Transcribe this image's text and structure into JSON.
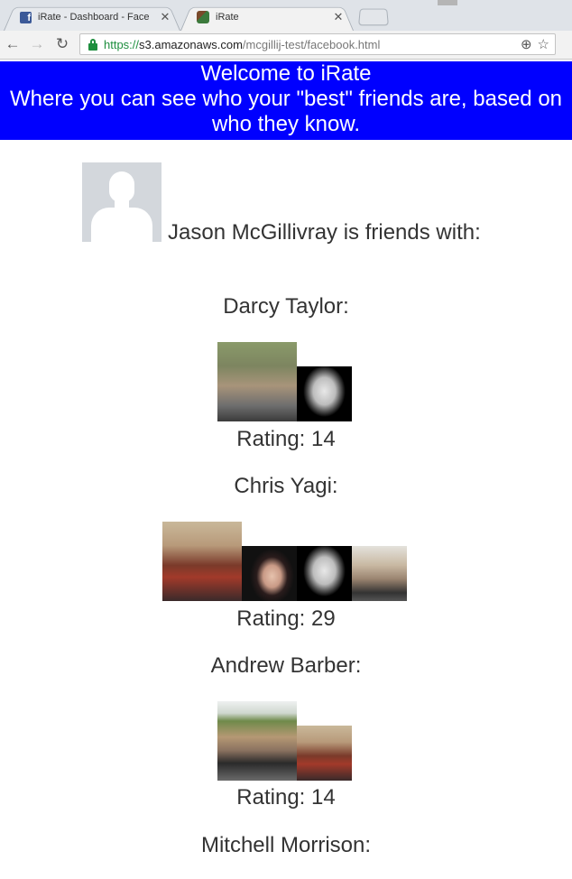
{
  "browser": {
    "tabs": [
      {
        "label": "iRate - Dashboard - Face",
        "icon": "facebook-icon",
        "active": false
      },
      {
        "label": "iRate",
        "icon": "irate-favicon-icon",
        "active": true
      }
    ],
    "url": {
      "scheme": "https://",
      "host": "s3.amazonaws.com",
      "path": "/mcgillij-test/facebook.html"
    },
    "fb_letter": "f"
  },
  "banner": {
    "line1": "Welcome to iRate",
    "line2": "Where you can see who your \"best\" friends are, based on",
    "line3": "who they know.",
    "color": "#0000ff"
  },
  "profile": {
    "text": "Jason McGillivray is friends with:"
  },
  "friends": [
    {
      "name": "Darcy Taylor:",
      "rating": "Rating: 14"
    },
    {
      "name": "Chris Yagi:",
      "rating": "Rating: 29"
    },
    {
      "name": "Andrew Barber:",
      "rating": "Rating: 14"
    },
    {
      "name": "Mitchell Morrison:"
    }
  ]
}
